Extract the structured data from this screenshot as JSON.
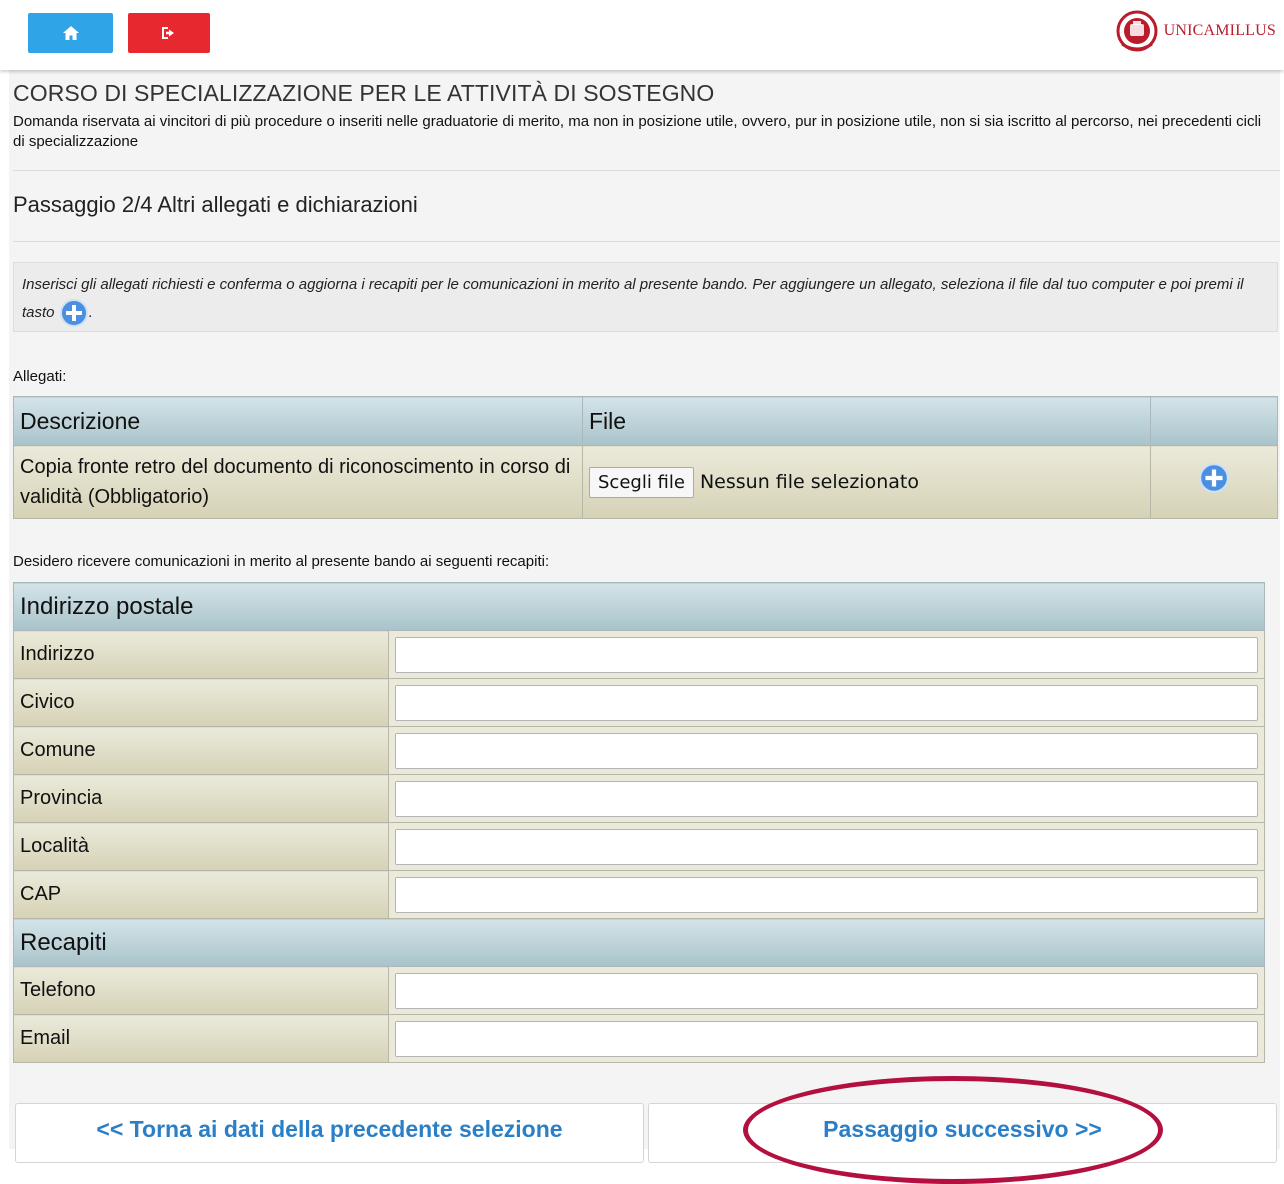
{
  "header": {
    "home_icon": "home-icon",
    "logout_icon": "logout-icon",
    "logo_text": "UNICAMILLUS",
    "brand_color": "#b91d2c"
  },
  "page": {
    "title": "CORSO DI SPECIALIZZAZIONE PER LE ATTIVITÀ DI SOSTEGNO",
    "subtitle": "Domanda riservata ai vincitori di più procedure o inseriti nelle graduatorie di merito, ma non in posizione utile, ovvero, pur in posizione utile, non si sia iscritto al percorso, nei precedenti cicli di specializzazione",
    "step": "Passaggio 2/4 Altri allegati e dichiarazioni",
    "info_text": "Inserisci gli allegati richiesti e conferma o aggiorna i recapiti per le comunicazioni in merito al presente bando. Per aggiungere un allegato, seleziona il file dal tuo computer e poi premi il tasto",
    "info_suffix": "."
  },
  "attachments": {
    "label": "Allegati:",
    "headers": [
      "Descrizione",
      "File",
      ""
    ],
    "rows": [
      {
        "description": "Copia fronte retro del documento di riconoscimento in corso di validità (Obbligatorio)",
        "file_button": "Scegli file",
        "file_status": "Nessun file selezionato"
      }
    ]
  },
  "contacts": {
    "label": "Desidero ricevere comunicazioni in merito al presente bando ai seguenti recapiti:",
    "postal_section": "Indirizzo postale",
    "postal_fields": [
      {
        "label": "Indirizzo",
        "value": ""
      },
      {
        "label": "Civico",
        "value": ""
      },
      {
        "label": "Comune",
        "value": ""
      },
      {
        "label": "Provincia",
        "value": ""
      },
      {
        "label": "Località",
        "value": ""
      },
      {
        "label": "CAP",
        "value": ""
      }
    ],
    "recapiti_section": "Recapiti",
    "recapiti_fields": [
      {
        "label": "Telefono",
        "value": ""
      },
      {
        "label": "Email",
        "value": ""
      }
    ]
  },
  "navigation": {
    "prev_label": "<< Torna ai dati della precedente selezione",
    "next_label": "Passaggio successivo >>",
    "link_color": "#2a7fc7",
    "highlight_color": "#b3103f"
  }
}
